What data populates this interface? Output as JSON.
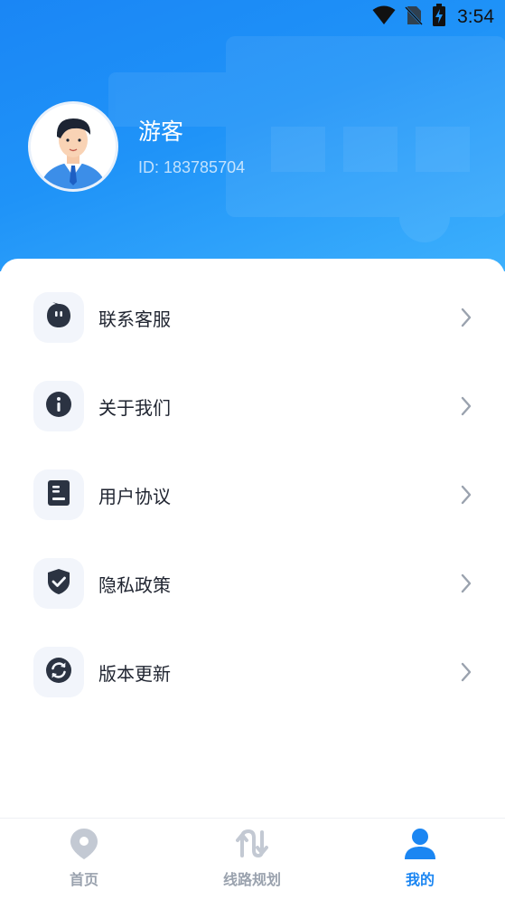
{
  "status_bar": {
    "time": "3:54",
    "icons": [
      "wifi-icon",
      "no-sim-icon",
      "battery-charging-icon"
    ]
  },
  "profile": {
    "name": "游客",
    "id_text": "ID: 183785704",
    "avatar": "user-avatar"
  },
  "menu": {
    "items": [
      {
        "label": "联系客服",
        "icon": "chat-bubble-icon"
      },
      {
        "label": "关于我们",
        "icon": "info-icon"
      },
      {
        "label": "用户协议",
        "icon": "document-icon"
      },
      {
        "label": "隐私政策",
        "icon": "shield-check-icon"
      },
      {
        "label": "版本更新",
        "icon": "refresh-icon"
      }
    ]
  },
  "tabbar": {
    "tabs": [
      {
        "label": "首页",
        "icon": "location-pin-icon",
        "active": false
      },
      {
        "label": "线路规划",
        "icon": "route-icon",
        "active": false
      },
      {
        "label": "我的",
        "icon": "person-icon",
        "active": true
      }
    ]
  },
  "colors": {
    "header_start": "#1a86f5",
    "header_end": "#3db0fc",
    "active_tab": "#1b86f2",
    "inactive_tab": "#9aa2ae",
    "menu_icon": "#2b3342"
  }
}
